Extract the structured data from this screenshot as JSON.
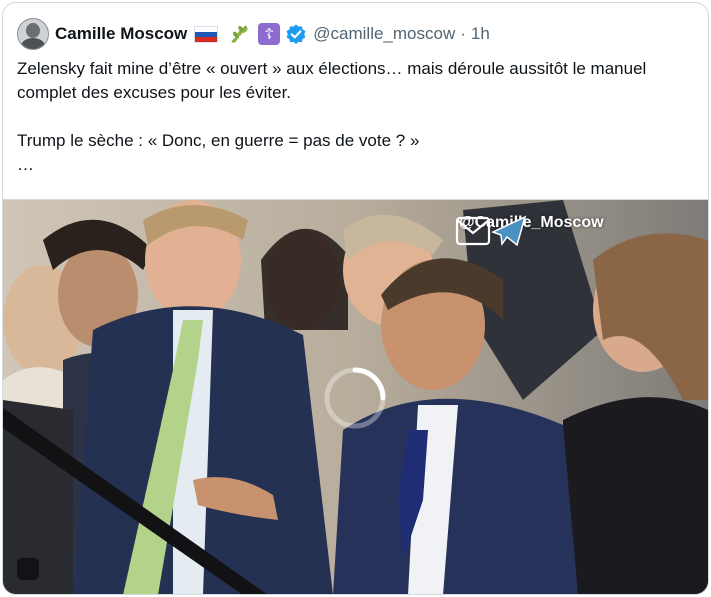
{
  "tweet": {
    "author_name": "Camille Moscow",
    "handle": "@camille_moscow",
    "separator": "·",
    "time": "1h",
    "icons": [
      "russia-flag-icon",
      "olive-branch-icon",
      "orthodox-cross-icon",
      "verified-badge-icon"
    ],
    "text": "Zelensky fait mine d’être « ouvert » aux élections… mais déroule aussitôt le manuel complet des excuses pour les éviter.\n\nTrump le sèche : « Donc, en guerre = pas de vote ? »\n…"
  },
  "media": {
    "watermark": "@Camille_Moscow",
    "player_state": "loading",
    "colors": {
      "verified": "#1d9bf0",
      "flag_white": "#ffffff",
      "flag_blue": "#1c57b5",
      "flag_red": "#d52b1e"
    }
  }
}
